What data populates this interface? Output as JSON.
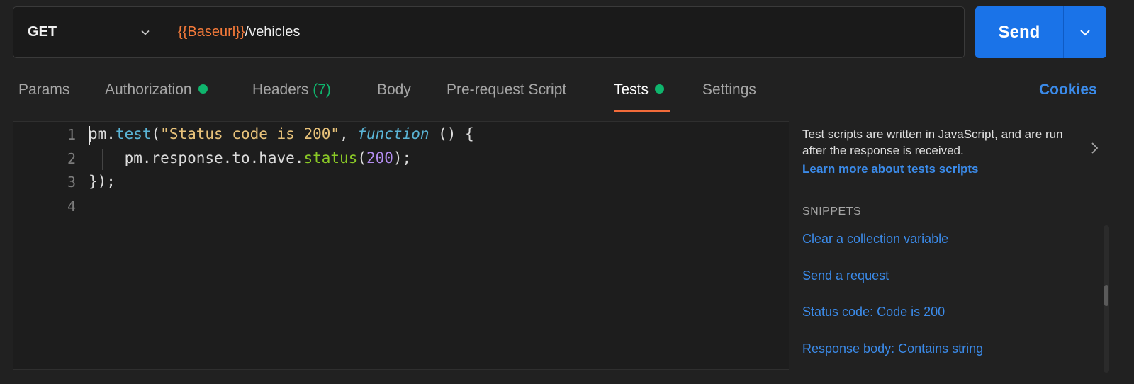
{
  "request": {
    "method": "GET",
    "url_variable": "{{Baseurl}}",
    "url_path": "/vehicles",
    "send_label": "Send"
  },
  "tabs": [
    {
      "label": "Params"
    },
    {
      "label": "Authorization"
    },
    {
      "label": "Headers",
      "count": "(7)"
    },
    {
      "label": "Body"
    },
    {
      "label": "Pre-request Script"
    },
    {
      "label": "Tests"
    },
    {
      "label": "Settings"
    }
  ],
  "cookies_label": "Cookies",
  "editor": {
    "line_numbers": [
      "1",
      "2",
      "3",
      "4"
    ],
    "code": {
      "l1_obj": "pm.",
      "l1_fn": "test",
      "l1_open": "(",
      "l1_str": "\"Status code is 200\"",
      "l1_comma": ", ",
      "l1_kw": "function",
      "l1_rest": " () {",
      "l2_indent": "    ",
      "l2_obj": "pm.response.to.have.",
      "l2_fn": "status",
      "l2_open": "(",
      "l2_num": "200",
      "l2_close": ");",
      "l3": "});"
    }
  },
  "panel": {
    "description": "Test scripts are written in JavaScript, and are run after the response is received.",
    "learn_more": "Learn more about tests scripts",
    "snippets_heading": "SNIPPETS",
    "snippets": [
      "Clear a collection variable",
      "Send a request",
      "Status code: Code is 200",
      "Response body: Contains string"
    ]
  },
  "colors": {
    "accent": "#1a73e8",
    "tab_underline": "#f26b3a",
    "status_dot": "#0fb56d",
    "link": "#3b8bea",
    "variable": "#f47a3a"
  }
}
